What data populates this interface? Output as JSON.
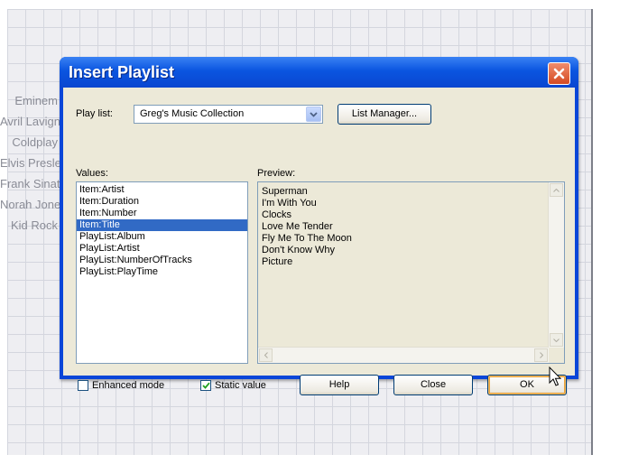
{
  "background": {
    "artists": [
      "Eminem",
      "Avril Lavigne",
      "Coldplay",
      "Elvis Presley",
      "Frank Sinatra",
      "Norah Jones",
      "Kid Rock"
    ]
  },
  "dialog": {
    "title": "Insert Playlist",
    "playlist_label": "Play list:",
    "playlist_value": "Greg's Music Collection",
    "list_manager_label": "List Manager...",
    "values_label": "Values:",
    "preview_label": "Preview:",
    "values": [
      "Item:Artist",
      "Item:Duration",
      "Item:Number",
      "Item:Title",
      "PlayList:Album",
      "PlayList:Artist",
      "PlayList:NumberOfTracks",
      "PlayList:PlayTime"
    ],
    "selected_value_index": 3,
    "preview": [
      "Superman",
      "I'm With You",
      "Clocks",
      "Love Me Tender",
      "Fly Me To The Moon",
      "Don't Know Why",
      "Picture"
    ],
    "enhanced_mode_label": "Enhanced mode",
    "enhanced_mode_checked": false,
    "static_value_label": "Static value",
    "static_value_checked": true,
    "help_label": "Help",
    "close_label": "Close",
    "ok_label": "OK"
  },
  "colors": {
    "title_bar": "#0a55e0",
    "selection": "#316ac5",
    "close_button": "#d44a22",
    "dialog_face": "#ece9d8"
  },
  "icons": [
    "close-icon",
    "chevron-down-icon",
    "scroll-up-icon",
    "scroll-down-icon",
    "scroll-left-icon",
    "scroll-right-icon",
    "check-icon",
    "mouse-pointer-icon"
  ]
}
